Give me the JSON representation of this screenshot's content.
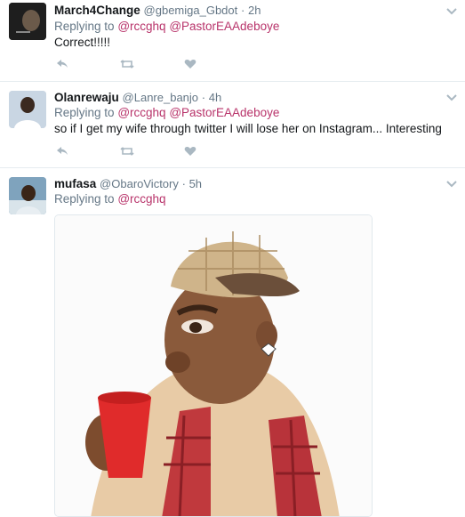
{
  "tweets": [
    {
      "name": "March4Change",
      "handle": "@gbemiga_Gbdot",
      "time": "· 2h",
      "replying_prefix": "Replying to",
      "mentions": [
        "@rccghq",
        "@PastorEAAdeboye"
      ],
      "text": "Correct!!!!!"
    },
    {
      "name": "Olanrewaju",
      "handle": "@Lanre_banjo",
      "time": "· 4h",
      "replying_prefix": "Replying to",
      "mentions": [
        "@rccghq",
        "@PastorEAAdeboye"
      ],
      "text": "so if I get my wife through twitter I will lose her on Instagram... Interesting"
    },
    {
      "name": "mufasa",
      "handle": "@ObaroVictory",
      "time": "· 5h",
      "replying_prefix": "Replying to",
      "mentions": [
        "@rccghq"
      ],
      "text": ""
    }
  ],
  "icons": [
    "reply-icon",
    "retweet-icon",
    "like-icon",
    "chevron-down-icon"
  ],
  "colors": {
    "mention": "#b8336a",
    "muted": "#657786",
    "icon": "#aab8c2",
    "divider": "#e6ecf0"
  }
}
